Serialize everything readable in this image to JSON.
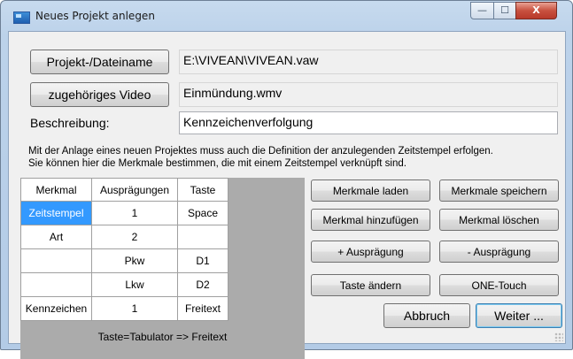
{
  "window": {
    "title": "Neues Projekt anlegen",
    "controls": {
      "minimize": "—",
      "maximize": "☐",
      "close": "X"
    }
  },
  "project": {
    "filename_button": "Projekt-/Dateiname",
    "filename_value": "E:\\VIVEAN\\VIVEAN.vaw",
    "video_button": "zugehöriges Video",
    "video_value": "Einmündung.wmv",
    "description_label": "Beschreibung:",
    "description_value": "Kennzeichenverfolgung"
  },
  "info_text": {
    "line1": "Mit der Anlage eines neuen Projektes muss auch die Definition der anzulegenden Zeitstempel erfolgen.",
    "line2": "Sie können hier die Merkmale bestimmen, die mit einem Zeitstempel verknüpft sind."
  },
  "grid": {
    "headers": [
      "Merkmal",
      "Ausprägungen",
      "Taste"
    ],
    "rows": [
      [
        "Zeitstempel",
        "1",
        "Space"
      ],
      [
        "Art",
        "2",
        ""
      ],
      [
        "",
        "Pkw",
        "D1"
      ],
      [
        "",
        "Lkw",
        "D2"
      ],
      [
        "Kennzeichen",
        "1",
        "Freitext"
      ]
    ],
    "footer": "Taste=Tabulator => Freitext"
  },
  "actions": {
    "load": "Merkmale laden",
    "save": "Merkmale speichern",
    "add": "Merkmal hinzufügen",
    "delete": "Merkmal löschen",
    "add_value": "+ Ausprägung",
    "remove_value": "- Ausprägung",
    "change_key": "Taste ändern",
    "one_touch": "ONE-Touch",
    "cancel": "Abbruch",
    "next": "Weiter ..."
  }
}
